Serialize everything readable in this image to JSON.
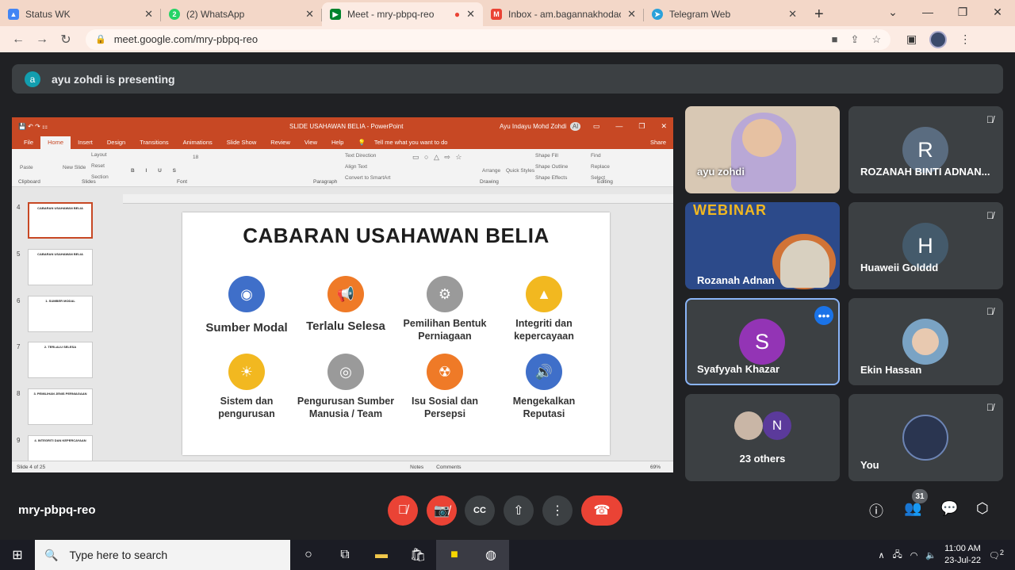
{
  "browser": {
    "tabs": [
      {
        "title": "Status WK",
        "icon": "drive-icon",
        "color": "#3b82f6"
      },
      {
        "title": "(2) WhatsApp",
        "icon": "whatsapp-icon",
        "color": "#25d366"
      },
      {
        "title": "Meet - mry-pbpq-reo",
        "icon": "meet-icon",
        "color": "#00832d"
      },
      {
        "title": "Inbox - am.bagannakhodaon",
        "icon": "gmail-icon",
        "color": "#ea4335"
      },
      {
        "title": "Telegram Web",
        "icon": "telegram-icon",
        "color": "#2aa1da"
      }
    ],
    "url": "meet.google.com/mry-pbpq-reo"
  },
  "presenting_banner": {
    "initial": "a",
    "text": "ayu zohdi is presenting"
  },
  "powerpoint": {
    "title": "SLIDE USAHAWAN BELIA - PowerPoint",
    "user": "Ayu Indayu Mohd Zohdi",
    "user_initials": "AI",
    "menu": [
      "File",
      "Home",
      "Insert",
      "Design",
      "Transitions",
      "Animations",
      "Slide Show",
      "Review",
      "View",
      "Help",
      "Tell me what you want to do",
      "Share"
    ],
    "ribbon_groups": [
      "Clipboard",
      "Slides",
      "Font",
      "Paragraph",
      "Drawing",
      "Editing"
    ],
    "ribbon_items": [
      "Paste",
      "New Slide",
      "Layout",
      "Reset",
      "Section",
      "Text Direction",
      "Align Text",
      "Convert to SmartArt",
      "Arrange",
      "Quick Styles",
      "Shape Fill",
      "Shape Outline",
      "Shape Effects",
      "Find",
      "Replace",
      "Select",
      "18"
    ],
    "thumbnails": [
      {
        "num": "4",
        "title": "CABARAN USAHAWAN BELIA"
      },
      {
        "num": "5",
        "title": "CABARAN USAHAWAN BELIA"
      },
      {
        "num": "6",
        "title": "1. SUMBER MODAL"
      },
      {
        "num": "7",
        "title": "2. TERLALU SELESA"
      },
      {
        "num": "8",
        "title": "3. PEMILIHAN JENIS PERNIAGAAN"
      },
      {
        "num": "9",
        "title": "4. INTEGRITI DAN KEPERCAYAAN"
      }
    ],
    "slide": {
      "title": "CABARAN USAHAWAN BELIA",
      "items": [
        {
          "label": "Sumber Modal",
          "icon": "camera-icon",
          "color": "#3f6fc9"
        },
        {
          "label": "Terlalu Selesa",
          "icon": "megaphone-icon",
          "color": "#ef7a27"
        },
        {
          "label": "Pemilihan Bentuk Perniagaan",
          "icon": "gear-icon",
          "color": "#9a9a9a"
        },
        {
          "label": "Integriti dan kepercayaan",
          "icon": "image-icon",
          "color": "#f2b820"
        },
        {
          "label": "Sistem dan pengurusan",
          "icon": "weather-icon",
          "color": "#f2b820"
        },
        {
          "label": "Pengurusan Sumber Manusia / Team",
          "icon": "target-icon",
          "color": "#9a9a9a"
        },
        {
          "label": "Isu Sosial dan Persepsi",
          "icon": "radiation-icon",
          "color": "#ef7a27"
        },
        {
          "label": "Mengekalkan Reputasi",
          "icon": "speaker-icon",
          "color": "#3f6fc9"
        }
      ]
    },
    "status": {
      "slide_count": "Slide 4 of 25",
      "notes": "Notes",
      "comments": "Comments",
      "zoom": "69%"
    }
  },
  "participants": [
    {
      "name": "ayu zohdi",
      "type": "video",
      "color": "#d8c8b4"
    },
    {
      "name": "ROZANAH BINTI ADNAN...",
      "initial": "R",
      "color": "#5a6c80",
      "muted": true
    },
    {
      "name": "Rozanah Adnan",
      "type": "video",
      "color": "#2c4a8a",
      "poster_text": "WEBINAR"
    },
    {
      "name": "Huaweii Golddd",
      "initial": "H",
      "color": "#445a6b",
      "muted": true
    },
    {
      "name": "Syafyyah Khazar",
      "initial": "S",
      "color": "#9334b5",
      "active": true
    },
    {
      "name": "Ekin Hassan",
      "type": "photo",
      "color": "#7aa3c4",
      "muted": true
    },
    {
      "name": "23 others",
      "initial": "N",
      "color": "#5b3a9b"
    },
    {
      "name": "You",
      "type": "logo",
      "color": "#2a3550",
      "muted": true
    }
  ],
  "meeting": {
    "code": "mry-pbpq-reo",
    "participant_count": "31"
  },
  "taskbar": {
    "search_placeholder": "Type here to search",
    "time": "11:00 AM",
    "date": "23-Jul-22",
    "notifications": "2"
  }
}
